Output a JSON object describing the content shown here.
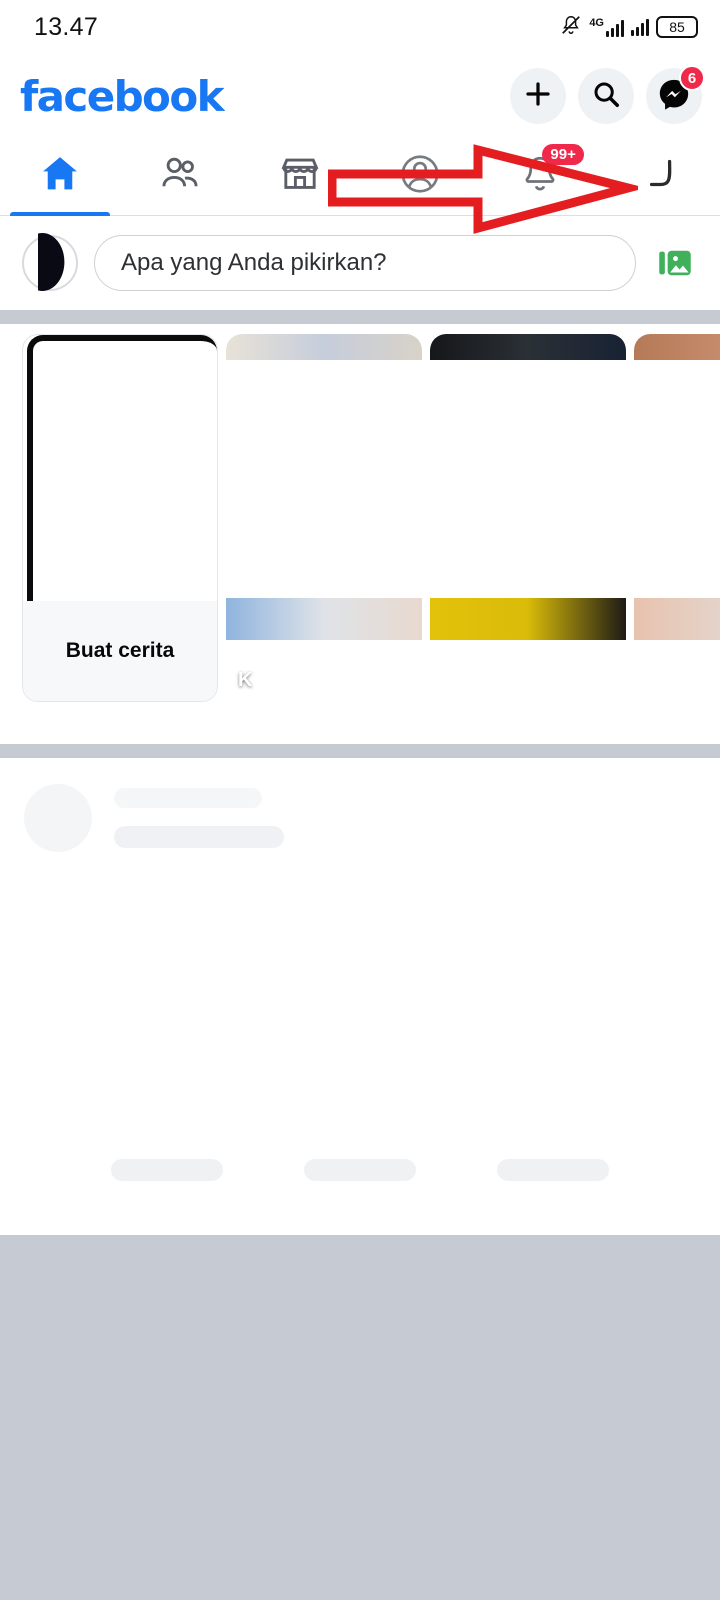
{
  "status_bar": {
    "time": "13.47",
    "network_label": "4G",
    "battery_level": "85",
    "icons": [
      "bell-muted-icon",
      "signal-4g-icon",
      "signal-bars-icon",
      "battery-icon"
    ]
  },
  "header": {
    "brand": "facebook",
    "brand_color": "#1877F2",
    "actions": [
      {
        "name": "create-button",
        "icon": "plus-icon",
        "badge": null
      },
      {
        "name": "search-button",
        "icon": "search-icon",
        "badge": null
      },
      {
        "name": "messenger-button",
        "icon": "messenger-icon",
        "badge": "6"
      }
    ],
    "badge_color": "#F02849"
  },
  "tabs": {
    "active_index": 0,
    "active_color": "#1877F2",
    "inactive_color": "#606770",
    "items": [
      {
        "name": "tab-home",
        "icon": "home-icon",
        "active": true,
        "badge": null
      },
      {
        "name": "tab-friends",
        "icon": "friends-icon",
        "active": false,
        "badge": null
      },
      {
        "name": "tab-marketplace",
        "icon": "marketplace-icon",
        "active": false,
        "badge": null
      },
      {
        "name": "tab-profile",
        "icon": "profile-circle-icon",
        "active": false,
        "badge": null
      },
      {
        "name": "tab-notifications",
        "icon": "bell-icon",
        "active": false,
        "badge": "99+"
      },
      {
        "name": "tab-menu",
        "icon": "hamburger-menu-icon",
        "active": false,
        "badge": null
      }
    ]
  },
  "composer": {
    "placeholder": "Apa yang Anda pikirkan?",
    "avatar": "user-avatar",
    "photo_icon": "photo-gallery-icon",
    "photo_icon_color": "#41B05B"
  },
  "stories": {
    "create_label": "Buat cerita",
    "cards": [
      {
        "name": "story-create-card",
        "label": "Buat cerita",
        "type": "create"
      },
      {
        "name": "story-card",
        "label": "K",
        "type": "thumbnail",
        "top_color": "#cfd4dc",
        "bottom_color": "#9fb8d8"
      },
      {
        "name": "story-card",
        "label": "",
        "type": "thumbnail",
        "top_color": "#1c2024",
        "bottom_color": "#e3c20a"
      },
      {
        "name": "story-card",
        "label": "",
        "type": "thumbnail",
        "top_color": "#c08b6a",
        "bottom_color": "#e9c4b0"
      }
    ]
  },
  "feed": {
    "loading": true,
    "skeleton_items": [
      "avatar",
      "title-line",
      "subtitle-line"
    ],
    "skeleton_actions": [
      "action-1",
      "action-2",
      "action-3"
    ]
  },
  "annotation": {
    "type": "arrow",
    "direction": "right",
    "color": "#E41E20",
    "target": "tab-menu"
  },
  "colors": {
    "page_background": "#FFFFFF",
    "divider": "#C6CAD2",
    "bottom_area": "#C6CAD2",
    "skeleton": "#F0F1F4"
  }
}
